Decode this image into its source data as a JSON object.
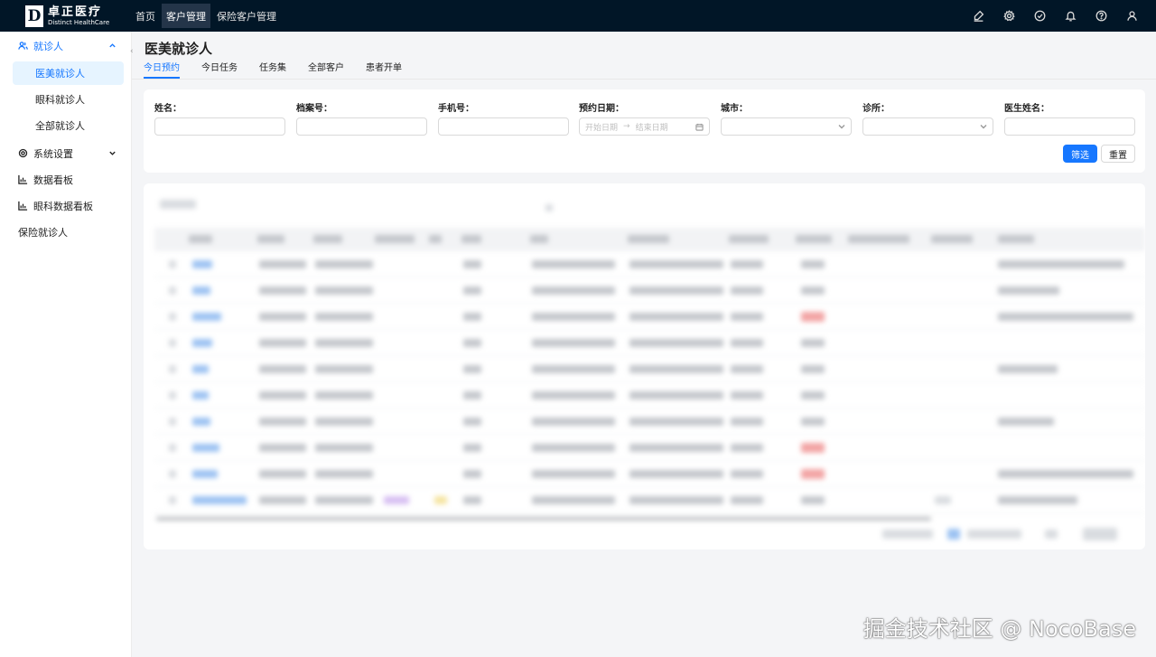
{
  "app": {
    "logo_text": "卓正医疗",
    "logo_subtext": "Distinct HealthCare",
    "logo_letter": "D"
  },
  "topnav": {
    "items": [
      {
        "label": "首页",
        "active": false
      },
      {
        "label": "客户管理",
        "active": true
      },
      {
        "label": "保险客户管理",
        "active": false
      }
    ],
    "icons": [
      "brush-icon",
      "gear-icon",
      "check-circle-icon",
      "bell-icon",
      "help-icon",
      "user-icon"
    ]
  },
  "sidebar": {
    "group_patients": "就诊人",
    "sub_items": [
      {
        "label": "医美就诊人",
        "active": true
      },
      {
        "label": "眼科就诊人",
        "active": false
      },
      {
        "label": "全部就诊人",
        "active": false
      }
    ],
    "system_settings": "系统设置",
    "data_board": "数据看板",
    "eye_data_board": "眼科数据看板",
    "insurance_patients": "保险就诊人"
  },
  "page": {
    "title": "医美就诊人",
    "tabs": [
      {
        "label": "今日预约",
        "active": true
      },
      {
        "label": "今日任务",
        "active": false
      },
      {
        "label": "任务集",
        "active": false
      },
      {
        "label": "全部客户",
        "active": false
      },
      {
        "label": "患者开单",
        "active": false
      }
    ]
  },
  "filters": {
    "name_label": "姓名：",
    "file_no_label": "档案号：",
    "phone_label": "手机号：",
    "date_label": "预约日期：",
    "date_start_placeholder": "开始日期",
    "date_end_placeholder": "结束日期",
    "city_label": "城市：",
    "clinic_label": "诊所：",
    "doctor_label": "医生姓名：",
    "filter_button": "筛选",
    "reset_button": "重置"
  },
  "watermark": "掘金技术社区 @ NocoBase",
  "colors": {
    "topbar_bg": "#011627",
    "primary": "#1677ff",
    "page_bg": "#f4f5f7"
  }
}
